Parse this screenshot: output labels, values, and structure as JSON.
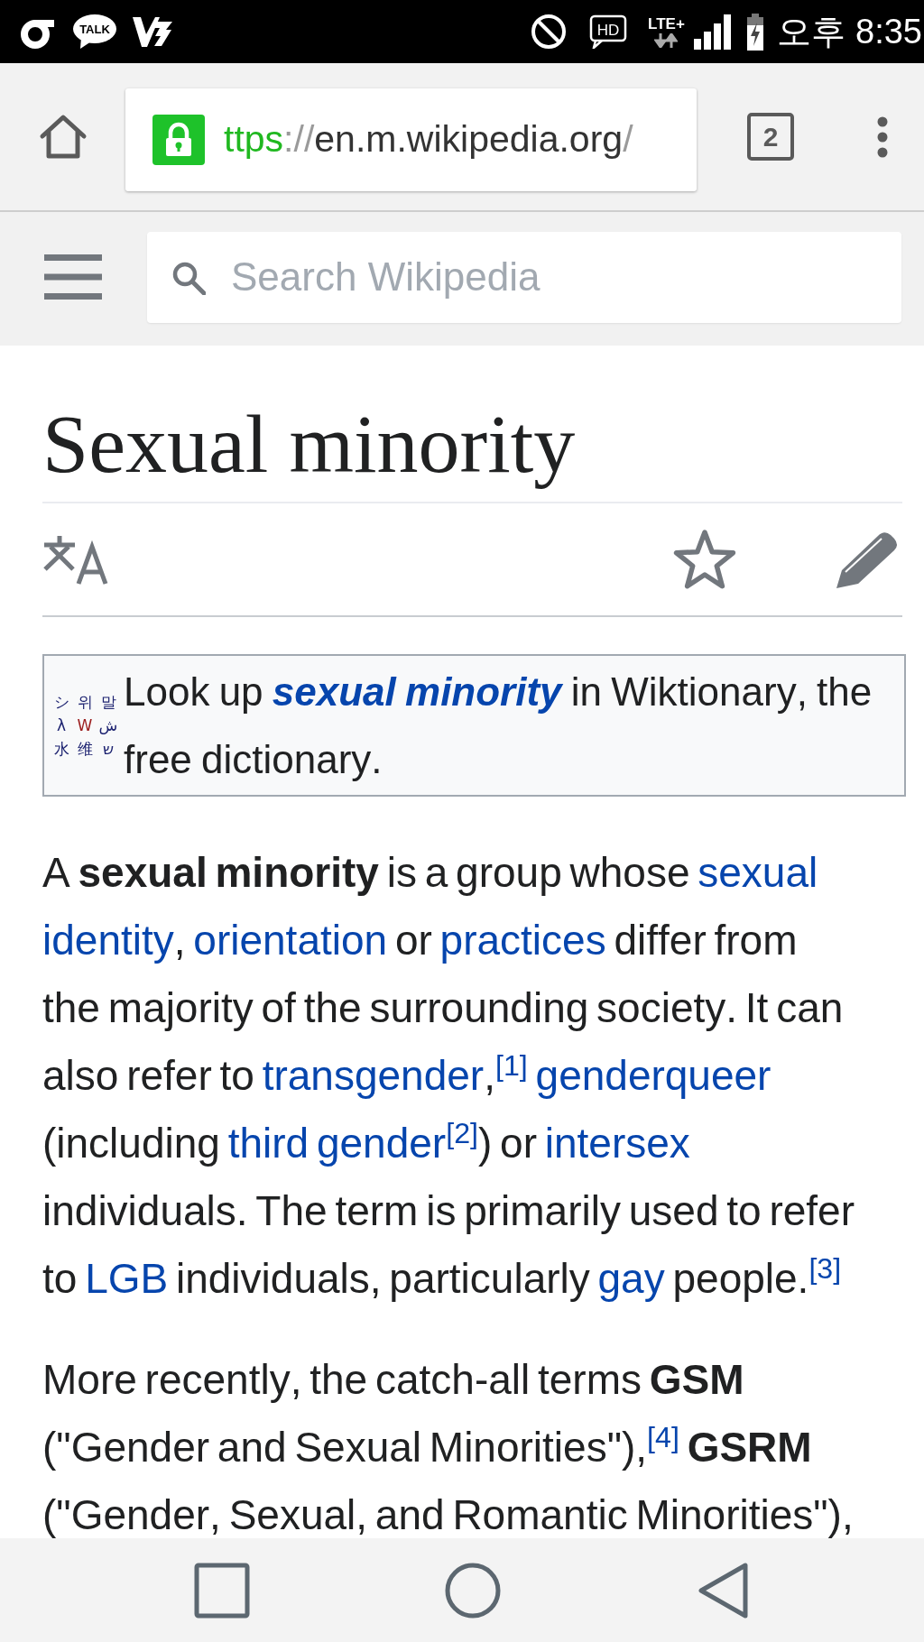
{
  "status_bar": {
    "chat_badge": "TALK",
    "hd_badge": "HD",
    "network": "LTE+",
    "time": "오후 8:35"
  },
  "browser": {
    "url": {
      "scheme": "ttps",
      "separator": "://",
      "host": "en.m.wikipedia.org",
      "path": "/"
    },
    "tab_count": "2"
  },
  "header": {
    "search": {
      "placeholder": "Search Wikipedia"
    }
  },
  "article": {
    "title": "Sexual minority",
    "watched": false,
    "wiktionary": {
      "logo": [
        {
          "text": "シ",
          "color": "#1c2270"
        },
        {
          "text": "위",
          "color": "#1c2270"
        },
        {
          "text": "말",
          "color": "#1c2270"
        },
        {
          "text": "λ",
          "color": "#1c2270"
        },
        {
          "text": "W",
          "color": "#9b1c1c"
        },
        {
          "text": "ش",
          "color": "#1c2270"
        },
        {
          "text": "水",
          "color": "#1c2270"
        },
        {
          "text": "维",
          "color": "#1c2270"
        },
        {
          "text": "ש",
          "color": "#1c2270"
        }
      ],
      "segments": [
        {
          "kind": "text",
          "text": "Look up "
        },
        {
          "kind": "strong-link",
          "text": "sexual minority"
        },
        {
          "kind": "text",
          "text": " in Wiktionary, the free dictionary."
        }
      ]
    },
    "paragraphs": [
      {
        "segments": [
          {
            "kind": "text",
            "text": "A "
          },
          {
            "kind": "bold",
            "text": "sexual minority"
          },
          {
            "kind": "text",
            "text": " is a group whose "
          },
          {
            "kind": "link",
            "text": "sexual"
          },
          {
            "kind": "link",
            "text": " identity"
          },
          {
            "kind": "text",
            "text": ", "
          },
          {
            "kind": "link",
            "text": "orientation"
          },
          {
            "kind": "text",
            "text": " or "
          },
          {
            "kind": "link",
            "text": "practices"
          },
          {
            "kind": "text",
            "text": " differ from the majority of the surrounding society. It can also refer to "
          },
          {
            "kind": "link",
            "text": "transgender"
          },
          {
            "kind": "text",
            "text": ","
          },
          {
            "kind": "ref",
            "text": "[1]"
          },
          {
            "kind": "link",
            "text": " genderqueer"
          },
          {
            "kind": "text",
            "text": " (including "
          },
          {
            "kind": "link",
            "text": "third gender"
          },
          {
            "kind": "ref",
            "text": "[2]"
          },
          {
            "kind": "text",
            "text": ") or "
          },
          {
            "kind": "link",
            "text": "intersex"
          },
          {
            "kind": "text",
            "text": " individuals. The term is primarily used to refer to "
          },
          {
            "kind": "link",
            "text": "LGB"
          },
          {
            "kind": "text",
            "text": " individuals, particularly "
          },
          {
            "kind": "link",
            "text": "gay"
          },
          {
            "kind": "text",
            "text": " people."
          },
          {
            "kind": "ref",
            "text": "[3]"
          }
        ]
      },
      {
        "segments": [
          {
            "kind": "text",
            "text": "More recently, the catch-all terms "
          },
          {
            "kind": "bold",
            "text": "GSM"
          },
          {
            "kind": "text",
            "text": " (\"Gender and Sexual Minorities\"),"
          },
          {
            "kind": "ref",
            "text": "[4]"
          },
          {
            "kind": "bold",
            "text": " GSRM"
          },
          {
            "kind": "text",
            "text": " (\"Gender, Sexual, and Romantic Minorities\"),"
          }
        ]
      }
    ]
  }
}
